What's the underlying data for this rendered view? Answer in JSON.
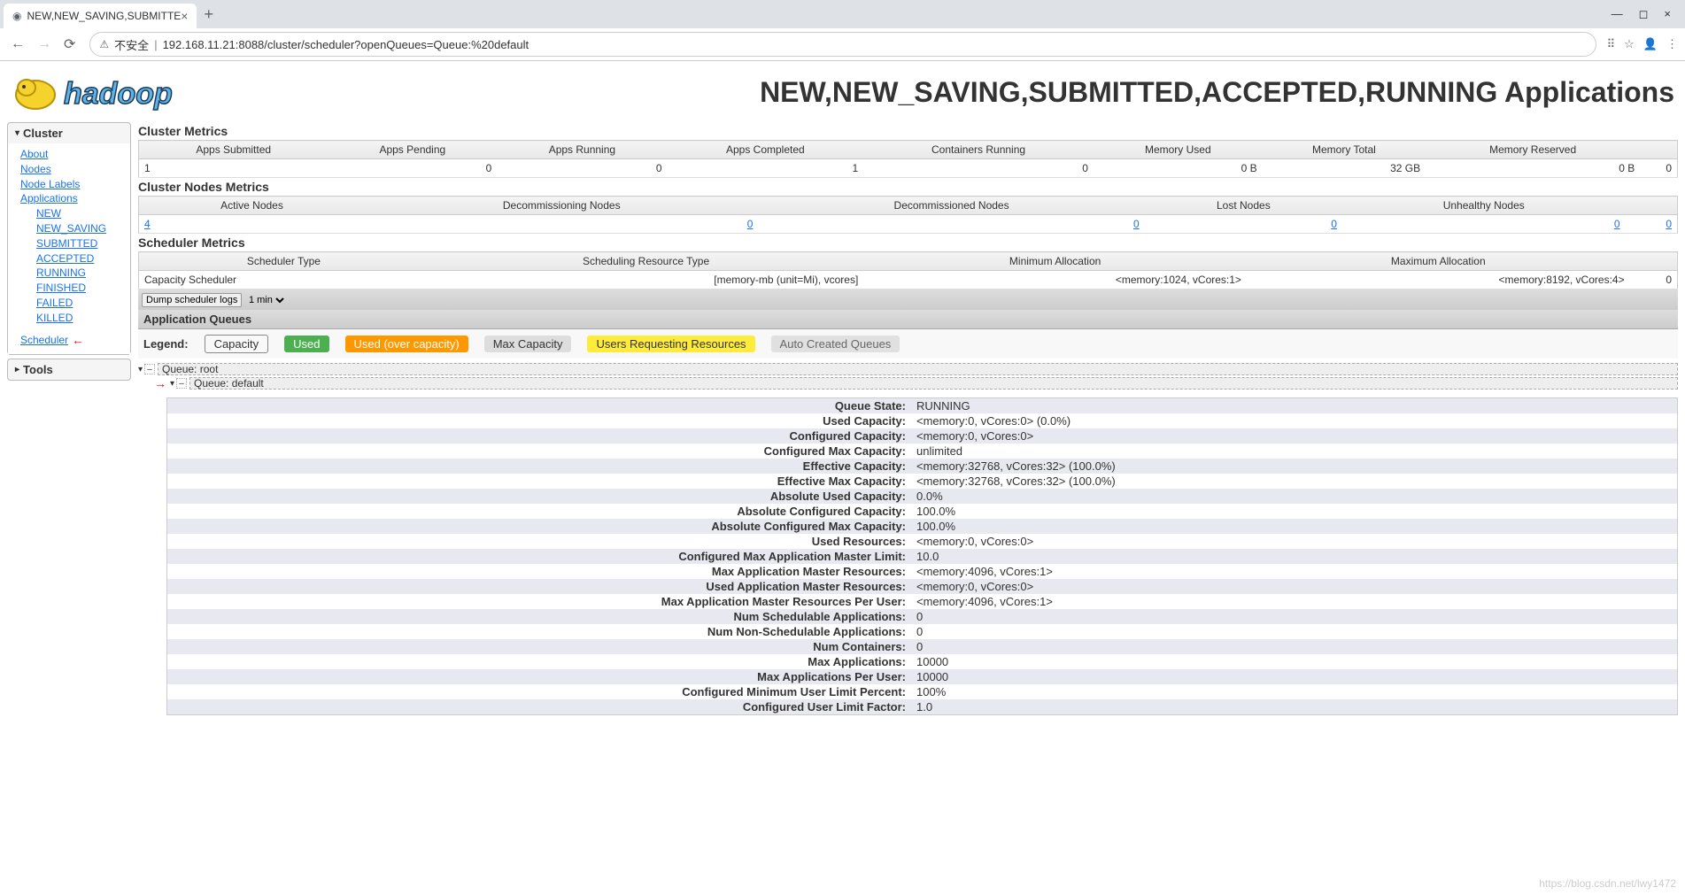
{
  "browser": {
    "tabTitle": "NEW,NEW_SAVING,SUBMITTE",
    "insecure": "不安全",
    "url": "192.168.11.21:8088/cluster/scheduler?openQueues=Queue:%20default"
  },
  "pageTitle": "NEW,NEW_SAVING,SUBMITTED,ACCEPTED,RUNNING Applications",
  "sidebar": {
    "clusterHeader": "Cluster",
    "about": "About",
    "nodes": "Nodes",
    "nodeLabels": "Node Labels",
    "applications": "Applications",
    "appStates": [
      "NEW",
      "NEW_SAVING",
      "SUBMITTED",
      "ACCEPTED",
      "RUNNING",
      "FINISHED",
      "FAILED",
      "KILLED"
    ],
    "scheduler": "Scheduler",
    "toolsHeader": "Tools"
  },
  "clusterMetrics": {
    "title": "Cluster Metrics",
    "headers": [
      "Apps Submitted",
      "Apps Pending",
      "Apps Running",
      "Apps Completed",
      "Containers Running",
      "Memory Used",
      "Memory Total",
      "Memory Reserved",
      ""
    ],
    "values": [
      "1",
      "0",
      "0",
      "1",
      "0",
      "0 B",
      "32 GB",
      "0 B",
      "0"
    ]
  },
  "nodesMetrics": {
    "title": "Cluster Nodes Metrics",
    "headers": [
      "Active Nodes",
      "Decommissioning Nodes",
      "Decommissioned Nodes",
      "Lost Nodes",
      "Unhealthy Nodes",
      ""
    ],
    "values": [
      "4",
      "0",
      "0",
      "0",
      "0",
      "0"
    ]
  },
  "schedMetrics": {
    "title": "Scheduler Metrics",
    "headers": [
      "Scheduler Type",
      "Scheduling Resource Type",
      "Minimum Allocation",
      "Maximum Allocation",
      ""
    ],
    "values": [
      "Capacity Scheduler",
      "[memory-mb (unit=Mi), vcores]",
      "<memory:1024, vCores:1>",
      "<memory:8192, vCores:4>",
      "0"
    ]
  },
  "dump": {
    "btn": "Dump scheduler logs",
    "time": "1 min"
  },
  "appQueues": {
    "title": "Application Queues",
    "legendLabel": "Legend:",
    "legend": {
      "capacity": "Capacity",
      "used": "Used",
      "over": "Used (over capacity)",
      "max": "Max Capacity",
      "users": "Users Requesting Resources",
      "auto": "Auto Created Queues"
    },
    "root": "Queue: root",
    "default": "Queue: default"
  },
  "queueDetails": [
    {
      "k": "Queue State:",
      "v": "RUNNING"
    },
    {
      "k": "Used Capacity:",
      "v": "<memory:0, vCores:0> (0.0%)"
    },
    {
      "k": "Configured Capacity:",
      "v": "<memory:0, vCores:0>"
    },
    {
      "k": "Configured Max Capacity:",
      "v": "unlimited"
    },
    {
      "k": "Effective Capacity:",
      "v": "<memory:32768, vCores:32> (100.0%)"
    },
    {
      "k": "Effective Max Capacity:",
      "v": "<memory:32768, vCores:32> (100.0%)"
    },
    {
      "k": "Absolute Used Capacity:",
      "v": "0.0%"
    },
    {
      "k": "Absolute Configured Capacity:",
      "v": "100.0%"
    },
    {
      "k": "Absolute Configured Max Capacity:",
      "v": "100.0%"
    },
    {
      "k": "Used Resources:",
      "v": "<memory:0, vCores:0>"
    },
    {
      "k": "Configured Max Application Master Limit:",
      "v": "10.0"
    },
    {
      "k": "Max Application Master Resources:",
      "v": "<memory:4096, vCores:1>"
    },
    {
      "k": "Used Application Master Resources:",
      "v": "<memory:0, vCores:0>"
    },
    {
      "k": "Max Application Master Resources Per User:",
      "v": "<memory:4096, vCores:1>"
    },
    {
      "k": "Num Schedulable Applications:",
      "v": "0"
    },
    {
      "k": "Num Non-Schedulable Applications:",
      "v": "0"
    },
    {
      "k": "Num Containers:",
      "v": "0"
    },
    {
      "k": "Max Applications:",
      "v": "10000"
    },
    {
      "k": "Max Applications Per User:",
      "v": "10000"
    },
    {
      "k": "Configured Minimum User Limit Percent:",
      "v": "100%"
    },
    {
      "k": "Configured User Limit Factor:",
      "v": "1.0"
    }
  ],
  "watermark": "https://blog.csdn.net/lwy1472"
}
